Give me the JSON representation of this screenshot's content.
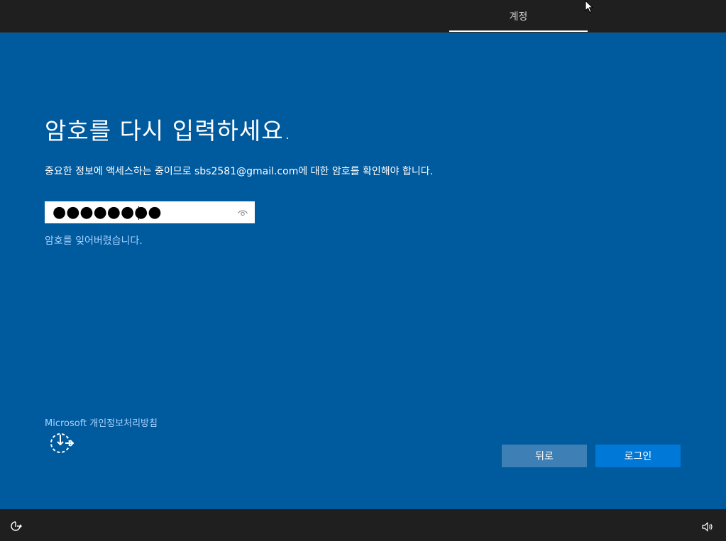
{
  "header": {
    "tab_label": "계정"
  },
  "main": {
    "title": "암호를 다시 입력하세요.",
    "description": "중요한 정보에 액세스하는 중이므로 sbs2581@gmail.com에 대한 암호를 확인해야 합니다.",
    "password_mask": "●●●●●●●●",
    "forgot_link": "암호를 잊어버렸습니다.",
    "privacy_link": "Microsoft 개인정보처리방침"
  },
  "buttons": {
    "back_label": "뒤로",
    "signin_label": "로그인"
  },
  "icons": {
    "reveal": "eye-icon",
    "ease_of_access": "ease-of-access-icon",
    "volume": "volume-icon",
    "cursor": "mouse-cursor-icon"
  },
  "colors": {
    "background": "#005a9e",
    "bar": "#1f1f1f",
    "link": "#a7d3ff",
    "primary_button": "#0078d7",
    "secondary_button": "#3e7fb6"
  }
}
